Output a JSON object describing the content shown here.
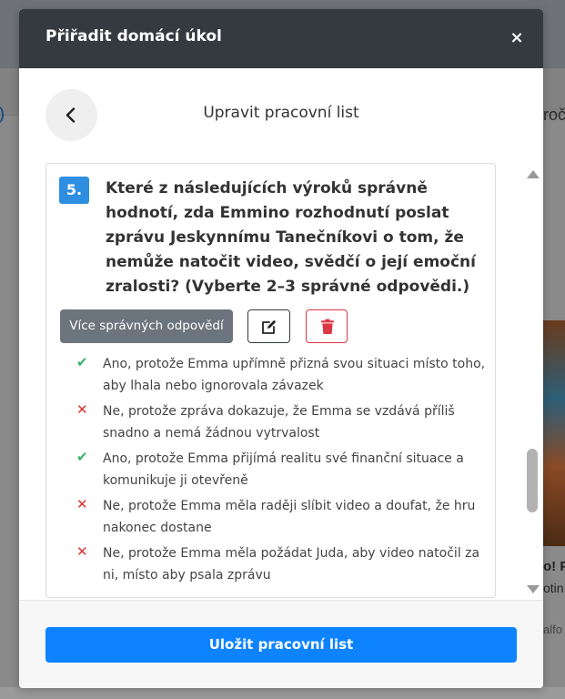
{
  "background": {
    "nav_text": "roč",
    "card_title": "o! P",
    "card_subtitle": "otin",
    "card_meta": "alfo"
  },
  "modal": {
    "title": "Přiřadit domácí úkol",
    "close_glyph": "×",
    "subtitle": "Upravit pracovní list",
    "question": {
      "number": "5.",
      "text": "Které z následujících výroků správně hodnotí, zda Emmino rozhodnutí poslat zprávu Jeskynnímu Tanečníkovi o tom, že nemůže natočit video, svědčí o její emoční zralosti? (Vyberte 2–3 správné odpovědi.)",
      "type_label": "Více správných odpovědí",
      "answers": [
        {
          "correct": true,
          "mark": "✔",
          "text": "Ano, protože Emma upřímně přizná svou situaci místo toho, aby lhala nebo ignorovala závazek"
        },
        {
          "correct": false,
          "mark": "✕",
          "text": "Ne, protože zpráva dokazuje, že Emma se vzdává příliš snadno a nemá žádnou vytrvalost"
        },
        {
          "correct": true,
          "mark": "✔",
          "text": "Ano, protože Emma přijímá realitu své finanční situace a komunikuje ji otevřeně"
        },
        {
          "correct": false,
          "mark": "✕",
          "text": "Ne, protože Emma měla raději slíbit video a doufat, že hru nakonec dostane"
        },
        {
          "correct": false,
          "mark": "✕",
          "text": "Ne, protože Emma měla požádat Juda, aby video natočil za ni, místo aby psala zprávu"
        }
      ]
    },
    "save_label": "Uložit pracovní list"
  },
  "colors": {
    "header_bg": "#343a40",
    "number_badge": "#2e8fe0",
    "type_badge": "#6c757d",
    "delete": "#dc3545",
    "correct": "#34b36b",
    "wrong": "#e03131",
    "primary": "#0d83ff"
  },
  "icons": {
    "back": "chevron-left-icon",
    "edit": "pencil-square-icon",
    "delete": "trash-icon",
    "close": "close-icon"
  }
}
